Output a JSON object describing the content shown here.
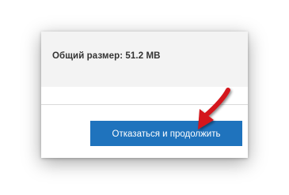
{
  "dialog": {
    "total_size_text": "Общий размер: 51.2 MB",
    "continue_button_label": "Отказаться и продолжить"
  },
  "annotation": {
    "arrow_color": "#d4141a",
    "arrow_icon": "red-arrow-icon"
  },
  "colors": {
    "button_background": "#1f73bd",
    "panel_background": "#f3f3f3"
  }
}
